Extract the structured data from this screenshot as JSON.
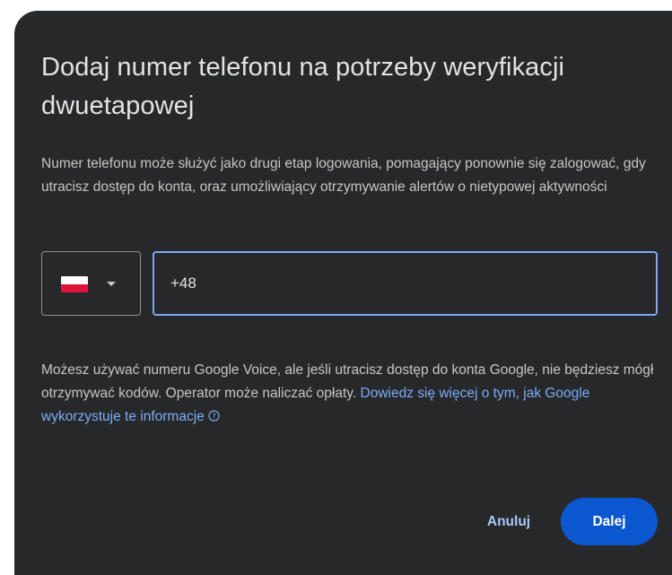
{
  "dialog": {
    "title": "Dodaj numer telefonu na potrzeby weryfikacji dwuetapowej",
    "description": "Numer telefonu może służyć jako drugi etap logowania, pomagający ponownie się zalogować, gdy utracisz dostęp do konta, oraz umożliwiający otrzymywanie alertów o nietypowej aktywności",
    "country_select": {
      "flag_icon": "poland-flag-icon",
      "dropdown_icon": "caret-down-icon"
    },
    "phone_input": {
      "value": "+48"
    },
    "note": {
      "text": "Możesz używać numeru Google Voice, ale jeśli utracisz dostęp do konta Google, nie będziesz mógł otrzymywać kodów. Operator może naliczać opłaty. ",
      "link": "Dowiedz się więcej o tym, jak Google wykorzystuje te informacje",
      "link_icon": "help-circle-icon"
    },
    "buttons": {
      "cancel": "Anuluj",
      "next": "Dalej"
    }
  },
  "colors": {
    "dialog_background": "#27282a",
    "primary_button": "#0b57d0",
    "link": "#7cacf8",
    "focus_border": "#7fa7f5"
  }
}
